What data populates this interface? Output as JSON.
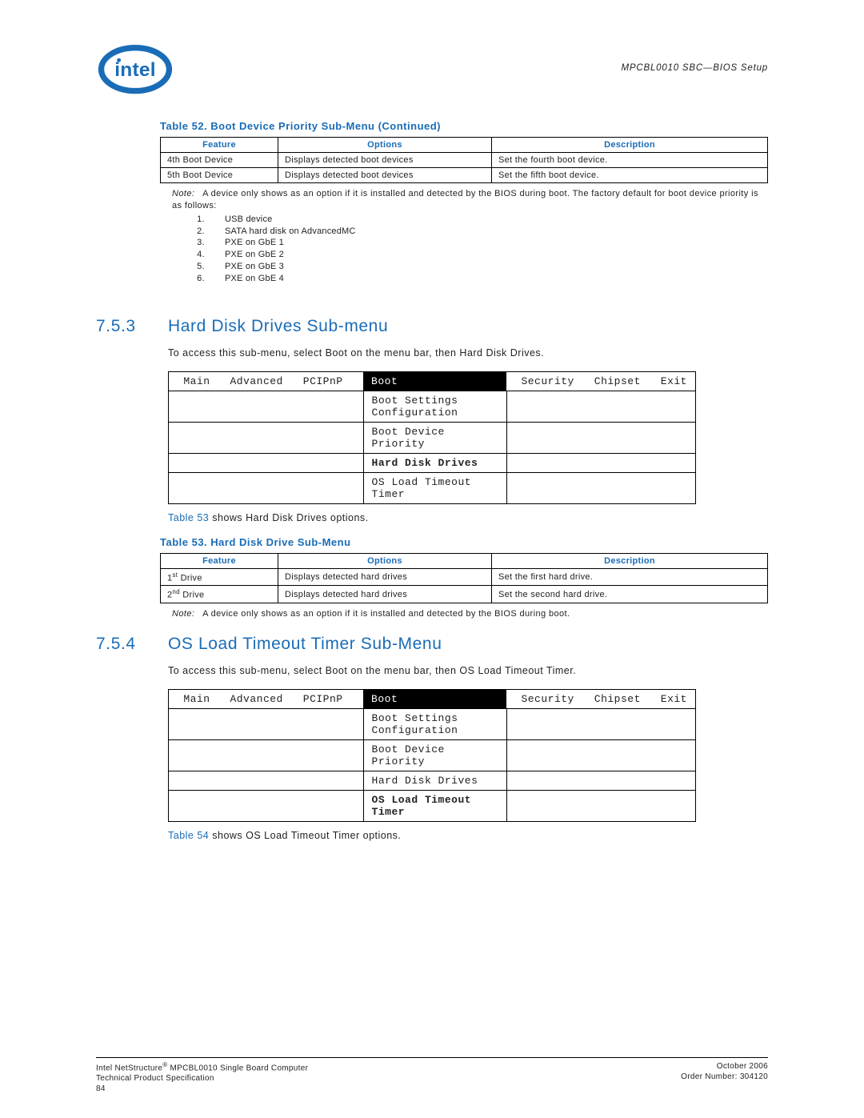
{
  "header_right": "MPCBL0010 SBC—BIOS Setup",
  "table52": {
    "caption": "Table 52.   Boot Device Priority Sub-Menu (Continued)",
    "h1": "Feature",
    "h2": "Options",
    "h3": "Description",
    "rows": [
      {
        "f": "4th Boot Device",
        "o": "Displays detected boot devices",
        "d": "Set the fourth boot device."
      },
      {
        "f": "5th Boot Device",
        "o": "Displays detected boot devices",
        "d": "Set the fifth boot device."
      }
    ],
    "note_label": "Note:",
    "note_text": "A device only shows as an option if it is installed and detected by the BIOS during boot. The factory default for boot device priority is as follows:",
    "note_items": [
      "USB device",
      "SATA hard disk on AdvancedMC",
      "PXE on GbE 1",
      "PXE on GbE 2",
      "PXE on GbE 3",
      "PXE on GbE 4"
    ]
  },
  "sec753": {
    "num": "7.5.3",
    "title": "Hard Disk Drives Sub-menu",
    "p": "To access this sub-menu, select Boot on the menu bar, then Hard Disk Drives.",
    "tabs": {
      "main": "Main",
      "adv": "Advanced",
      "pci": "PCIPnP",
      "boot": "Boot",
      "sec": "Security",
      "chip": "Chipset",
      "exit": "Exit"
    },
    "items": [
      "Boot Settings Configuration",
      "Boot Device Priority",
      "Hard Disk Drives",
      "OS Load Timeout Timer"
    ],
    "bold_index": 2,
    "after_link": "Table 53",
    "after_text": " shows Hard Disk Drives options."
  },
  "table53": {
    "caption": "Table 53.   Hard Disk Drive Sub-Menu",
    "h1": "Feature",
    "h2": "Options",
    "h3": "Description",
    "rows": [
      {
        "f_pre": "1",
        "f_sup": "st",
        "f_post": " Drive",
        "o": "Displays detected hard drives",
        "d": "Set the first hard drive."
      },
      {
        "f_pre": "2",
        "f_sup": "nd",
        "f_post": " Drive",
        "o": "Displays detected hard drives",
        "d": "Set the second hard drive."
      }
    ],
    "note_label": "Note:",
    "note_text": "A device only shows as an option if it is installed and detected by the BIOS during boot."
  },
  "sec754": {
    "num": "7.5.4",
    "title": "OS Load Timeout Timer Sub-Menu",
    "p": "To access this sub-menu, select Boot on the menu bar, then OS Load Timeout Timer.",
    "tabs": {
      "main": "Main",
      "adv": "Advanced",
      "pci": "PCIPnP",
      "boot": "Boot",
      "sec": "Security",
      "chip": "Chipset",
      "exit": "Exit"
    },
    "items": [
      "Boot Settings Configuration",
      "Boot Device Priority",
      "Hard Disk Drives",
      "OS Load Timeout Timer"
    ],
    "bold_index": 3,
    "after_link": "Table 54",
    "after_text": " shows OS Load Timeout Timer options."
  },
  "footer": {
    "l1": "Intel NetStructure",
    "lsup": "®",
    "l1b": " MPCBL0010 Single Board Computer",
    "l2": "Technical Product Specification",
    "l3": "84",
    "r1": "October 2006",
    "r2": "Order Number: 304120"
  }
}
